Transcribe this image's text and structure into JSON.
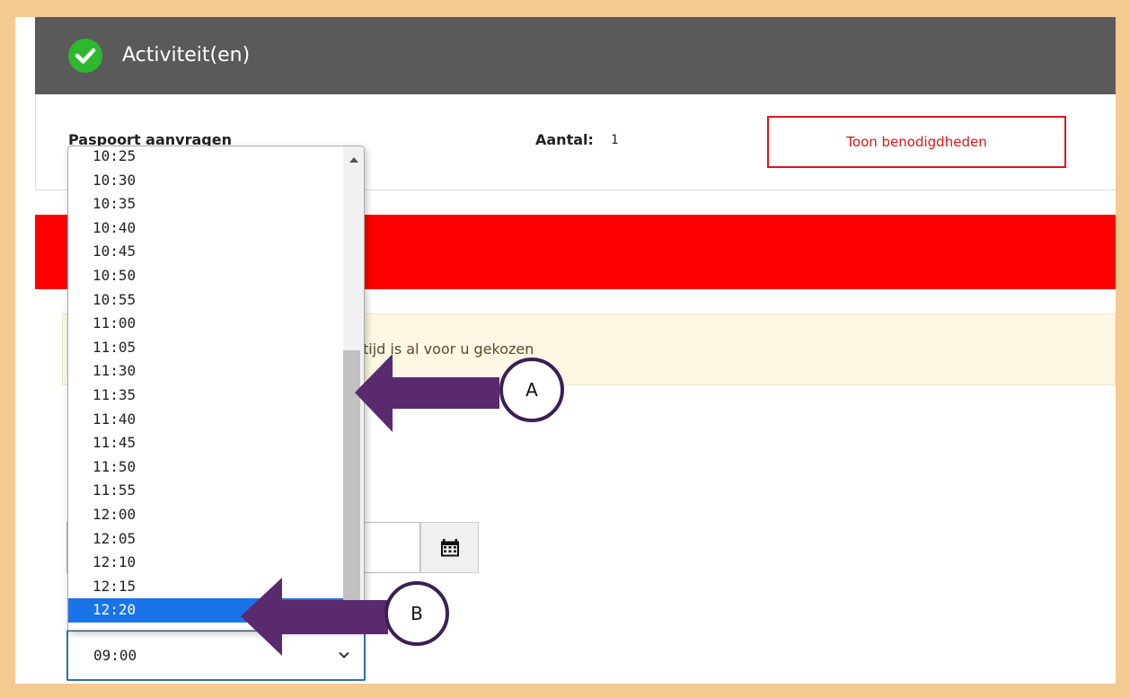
{
  "header": {
    "title": "Activiteit(en)"
  },
  "activity": {
    "name": "Paspoort aanvragen",
    "quantity_label": "Aantal:",
    "quantity_value": "1",
    "show_button_label": "Toon benodigdheden"
  },
  "notice": {
    "text": "tijd is al voor u gekozen"
  },
  "time_select": {
    "value": "09:00",
    "options": [
      "10:25",
      "10:30",
      "10:35",
      "10:40",
      "10:45",
      "10:50",
      "10:55",
      "11:00",
      "11:05",
      "11:30",
      "11:35",
      "11:40",
      "11:45",
      "11:50",
      "11:55",
      "12:00",
      "12:05",
      "12:10",
      "12:15",
      "12:20"
    ],
    "highlighted": "12:20"
  },
  "callouts": {
    "a": "A",
    "b": "B"
  },
  "colors": {
    "frame": "#f5c992",
    "header_bg": "#5a5a5a",
    "check_green": "#2eb82e",
    "alert_red": "#ff0000",
    "button_red": "#e0141a",
    "notice_bg": "#fcf8e3",
    "select_blue": "#1a73e8",
    "arrow_purple": "#5a2a6e"
  },
  "icons": [
    "check-icon",
    "calendar-icon",
    "chevron-down-icon",
    "scroll-up-icon"
  ]
}
